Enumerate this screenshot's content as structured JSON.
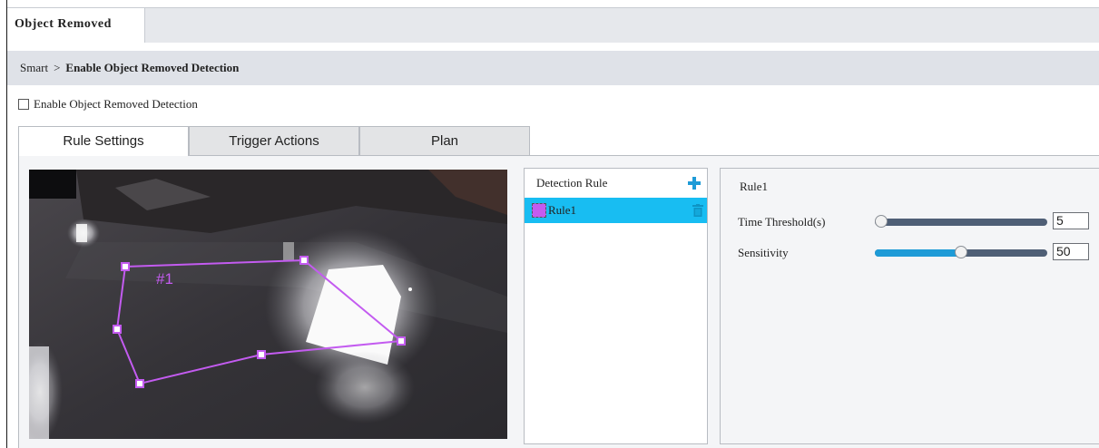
{
  "page_tab": {
    "label": "Object Removed"
  },
  "breadcrumb": {
    "root": "Smart",
    "separator": ">",
    "current": "Enable Object Removed Detection"
  },
  "enable_checkbox": {
    "label": "Enable Object Removed Detection",
    "checked": false
  },
  "subtabs": [
    {
      "label": "Rule Settings",
      "active": true
    },
    {
      "label": "Trigger Actions",
      "active": false
    },
    {
      "label": "Plan",
      "active": false
    }
  ],
  "video": {
    "region_label": "#1"
  },
  "detection_rule": {
    "header": "Detection Rule",
    "add_icon": "plus-icon",
    "rules": [
      {
        "name": "Rule1",
        "color": "#c35bf0",
        "selected": true,
        "delete_icon": "trash-icon"
      }
    ]
  },
  "rule_settings": {
    "title": "Rule1",
    "time_threshold": {
      "label": "Time Threshold(s)",
      "value": "5",
      "slider_fraction": 0.0
    },
    "sensitivity": {
      "label": "Sensitivity",
      "value": "50",
      "slider_fraction": 0.5
    }
  },
  "colors": {
    "accent": "#1e9bd7",
    "selected_row": "#18bdf2",
    "rule_color": "#c35bf0"
  }
}
